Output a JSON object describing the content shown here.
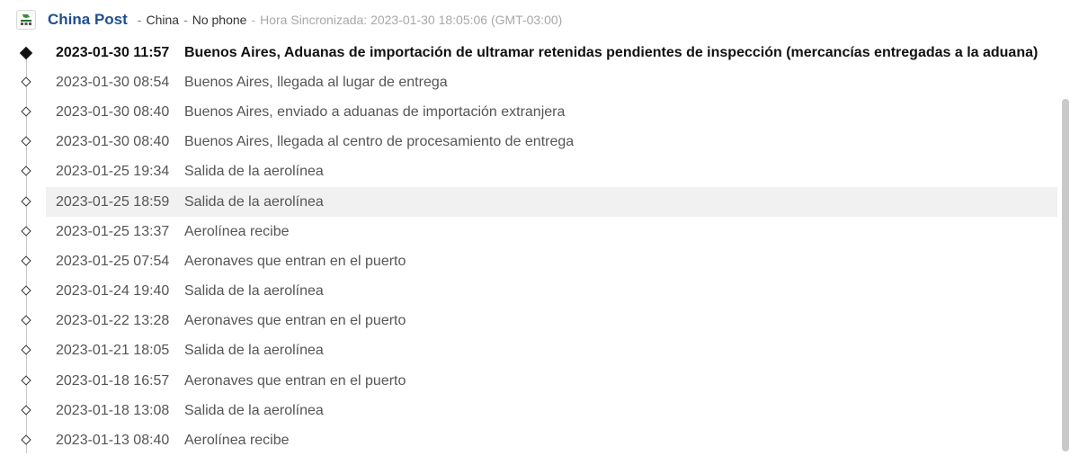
{
  "header": {
    "logo_icon": "china-post-logo-icon",
    "carrier": "China Post",
    "separator": "-",
    "country": "China",
    "phone": "No phone",
    "sync": "Hora Sincronizada: 2023-01-30 18:05:06 (GMT-03:00)"
  },
  "events": [
    {
      "time": "2023-01-30 11:57",
      "desc": "Buenos Aires, Aduanas de importación de ultramar retenidas pendientes de inspección (mercancías entregadas a la aduana)"
    },
    {
      "time": "2023-01-30 08:54",
      "desc": "Buenos Aires, llegada al lugar de entrega"
    },
    {
      "time": "2023-01-30 08:40",
      "desc": "Buenos Aires, enviado a aduanas de importación extranjera"
    },
    {
      "time": "2023-01-30 08:40",
      "desc": "Buenos Aires, llegada al centro de procesamiento de entrega"
    },
    {
      "time": "2023-01-25 19:34",
      "desc": "Salida de la aerolínea"
    },
    {
      "time": "2023-01-25 18:59",
      "desc": "Salida de la aerolínea"
    },
    {
      "time": "2023-01-25 13:37",
      "desc": "Aerolínea recibe"
    },
    {
      "time": "2023-01-25 07:54",
      "desc": "Aeronaves que entran en el puerto"
    },
    {
      "time": "2023-01-24 19:40",
      "desc": "Salida de la aerolínea"
    },
    {
      "time": "2023-01-22 13:28",
      "desc": "Aeronaves que entran en el puerto"
    },
    {
      "time": "2023-01-21 18:05",
      "desc": "Salida de la aerolínea"
    },
    {
      "time": "2023-01-18 16:57",
      "desc": "Aeronaves que entran en el puerto"
    },
    {
      "time": "2023-01-18 13:08",
      "desc": "Salida de la aerolínea"
    },
    {
      "time": "2023-01-13 08:40",
      "desc": "Aerolínea recibe"
    }
  ],
  "colors": {
    "carrier": "#1f4f8f",
    "current_text": "#111111",
    "event_text": "#555555",
    "sync_text": "#a8a8a8",
    "row_highlight": "#f1f1f1"
  }
}
